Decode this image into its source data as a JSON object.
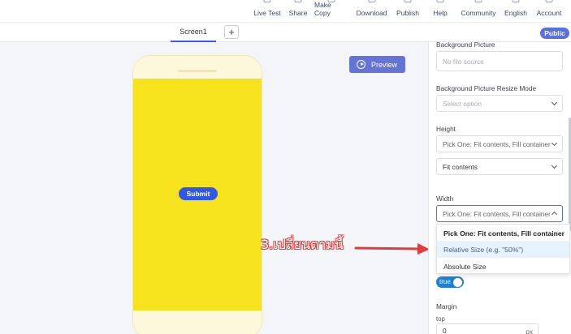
{
  "topbar": {
    "items": [
      {
        "label": "Live Test",
        "icon": "live-test-icon"
      },
      {
        "label": "Share",
        "icon": "share-icon"
      },
      {
        "label": "Make Copy",
        "icon": "copy-icon"
      },
      {
        "label": "Download",
        "icon": "download-icon"
      },
      {
        "label": "Publish",
        "icon": "publish-icon"
      },
      {
        "label": "Help",
        "icon": "help-icon"
      },
      {
        "label": "Community",
        "icon": "community-icon"
      },
      {
        "label": "English",
        "icon": "globe-icon"
      },
      {
        "label": "Account",
        "icon": "account-icon"
      }
    ]
  },
  "tabs": {
    "screen": "Screen1",
    "add": "+",
    "badge": "Public"
  },
  "canvas": {
    "submit_label": "Submit",
    "preview_label": "Preview"
  },
  "annotation": {
    "text": "3.เปลี่ยนตามนี้"
  },
  "panel": {
    "bg_picture_label": "Background Picture",
    "bg_picture_placeholder": "No file source",
    "resize_label": "Background Picture Resize Mode",
    "resize_placeholder": "Select option",
    "height_label": "Height",
    "height_mode": "Pick One: Fit contents, Fill container",
    "height_value": "Fit contents",
    "width_label": "Width",
    "width_mode": "Pick One: Fit contents, Fill container",
    "width_options": [
      "Pick One: Fit contents, Fill container",
      "Relative Size (e.g. \"50%\")",
      "Absolute Size"
    ],
    "toggle_label": "true",
    "margin_label": "Margin",
    "margin_top_label": "top",
    "margin_top_value": "0",
    "margin_unit": "px"
  },
  "colors": {
    "accent": "#3d5afe",
    "preview_bg": "#6673d6",
    "screen_bg": "#f7e21e",
    "annotation": "#e23b3b"
  }
}
